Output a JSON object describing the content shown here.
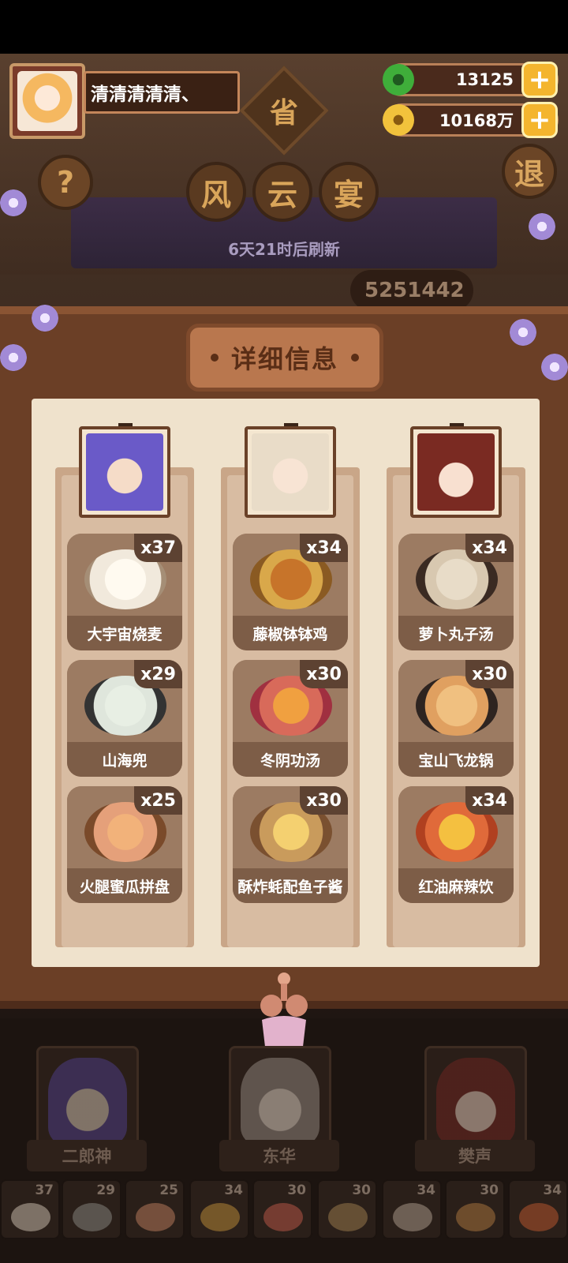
{
  "player": {
    "name": "清清清清清、"
  },
  "currency": [
    {
      "icon": "jade-coin-icon",
      "value": "13125",
      "color": "#3fae3a"
    },
    {
      "icon": "gold-coin-icon",
      "value": "10168万",
      "color": "#f2c23c"
    }
  ],
  "plus_label": "+",
  "help_label": "?",
  "exit_label": "退",
  "province_label": "省",
  "event_title": [
    "风",
    "云",
    "宴"
  ],
  "refresh_text": "6天21时后刷新",
  "score_text": "5251442",
  "panel": {
    "title": "详细信息"
  },
  "columns": [
    {
      "character": "二郎神",
      "portrait_color": "#6a5ac8",
      "dishes": [
        {
          "name": "大宇宙烧麦",
          "count": "x37",
          "color": "#f1e9dc"
        },
        {
          "name": "山海兜",
          "count": "x29",
          "color": "#dfe6dc"
        },
        {
          "name": "火腿蜜瓜拼盘",
          "count": "x25",
          "color": "#e5a07a"
        }
      ]
    },
    {
      "character": "东华",
      "portrait_color": "#e9dcc8",
      "dishes": [
        {
          "name": "藤椒钵钵鸡",
          "count": "x34",
          "color": "#d9a84a"
        },
        {
          "name": "冬阴功汤",
          "count": "x30",
          "color": "#d86a5a"
        },
        {
          "name": "酥炸蚝配鱼子酱",
          "count": "x30",
          "color": "#c99b5c"
        }
      ]
    },
    {
      "character": "樊声",
      "portrait_color": "#7a2a22",
      "dishes": [
        {
          "name": "萝卜丸子汤",
          "count": "x34",
          "color": "#d8c8b0"
        },
        {
          "name": "宝山飞龙锅",
          "count": "x30",
          "color": "#e0a060"
        },
        {
          "name": "红油麻辣饮",
          "count": "x34",
          "color": "#e06a3a"
        }
      ]
    }
  ],
  "bottom_counts": [
    "37",
    "29",
    "25",
    "34",
    "30",
    "30",
    "34",
    "30",
    "34"
  ]
}
